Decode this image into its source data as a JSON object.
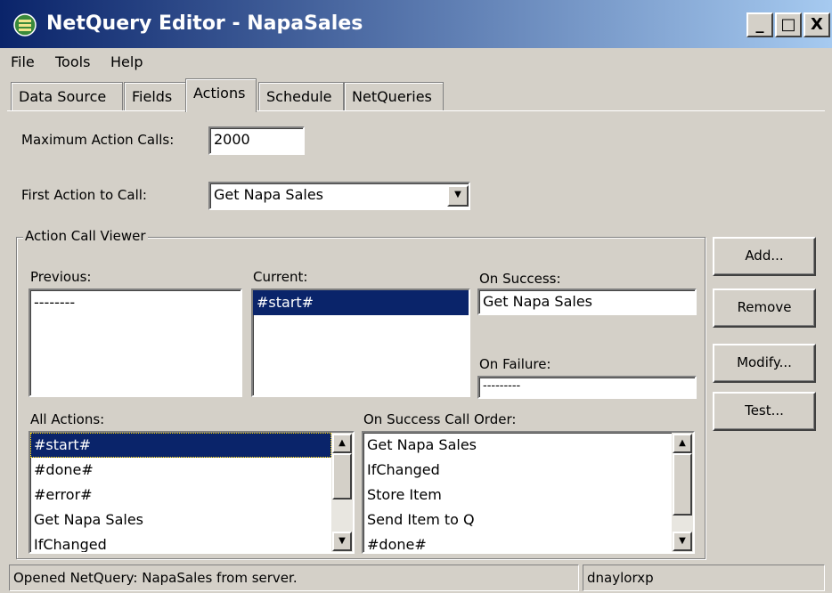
{
  "window": {
    "title": "NetQuery Editor - NapaSales",
    "min": "_",
    "max": "□",
    "close": "X"
  },
  "menu": [
    "File",
    "Tools",
    "Help"
  ],
  "tabs": [
    "Data Source",
    "Fields",
    "Actions",
    "Schedule",
    "NetQueries"
  ],
  "active_tab": "Actions",
  "form": {
    "max_calls_label": "Maximum Action Calls:",
    "max_calls_value": "2000",
    "first_action_label": "First Action to Call:",
    "first_action_value": "Get Napa Sales"
  },
  "viewer": {
    "title": "Action Call Viewer",
    "previous_label": "Previous:",
    "previous_items": [
      "--------"
    ],
    "current_label": "Current:",
    "current_items": [
      "#start#"
    ],
    "on_success_label": "On Success:",
    "on_success_value": "Get Napa Sales",
    "on_failure_label": "On Failure:",
    "on_failure_value": "---------",
    "all_actions_label": "All Actions:",
    "all_actions": [
      "#start#",
      "#done#",
      "#error#",
      "Get Napa Sales",
      "IfChanged"
    ],
    "call_order_label": "On Success Call Order:",
    "call_order": [
      "Get Napa Sales",
      "IfChanged",
      "Store Item",
      "Send Item to Q",
      "#done#"
    ]
  },
  "buttons": {
    "add": "Add...",
    "remove": "Remove",
    "modify": "Modify...",
    "test": "Test..."
  },
  "status": {
    "message": "Opened NetQuery: NapaSales from server.",
    "user": "dnaylorxp"
  },
  "icons": {
    "up": "▲",
    "down": "▼"
  },
  "colors": {
    "title_start": "#0a246a",
    "title_end": "#a6caf0",
    "selection": "#0a246a",
    "face": "#d4d0c8"
  }
}
